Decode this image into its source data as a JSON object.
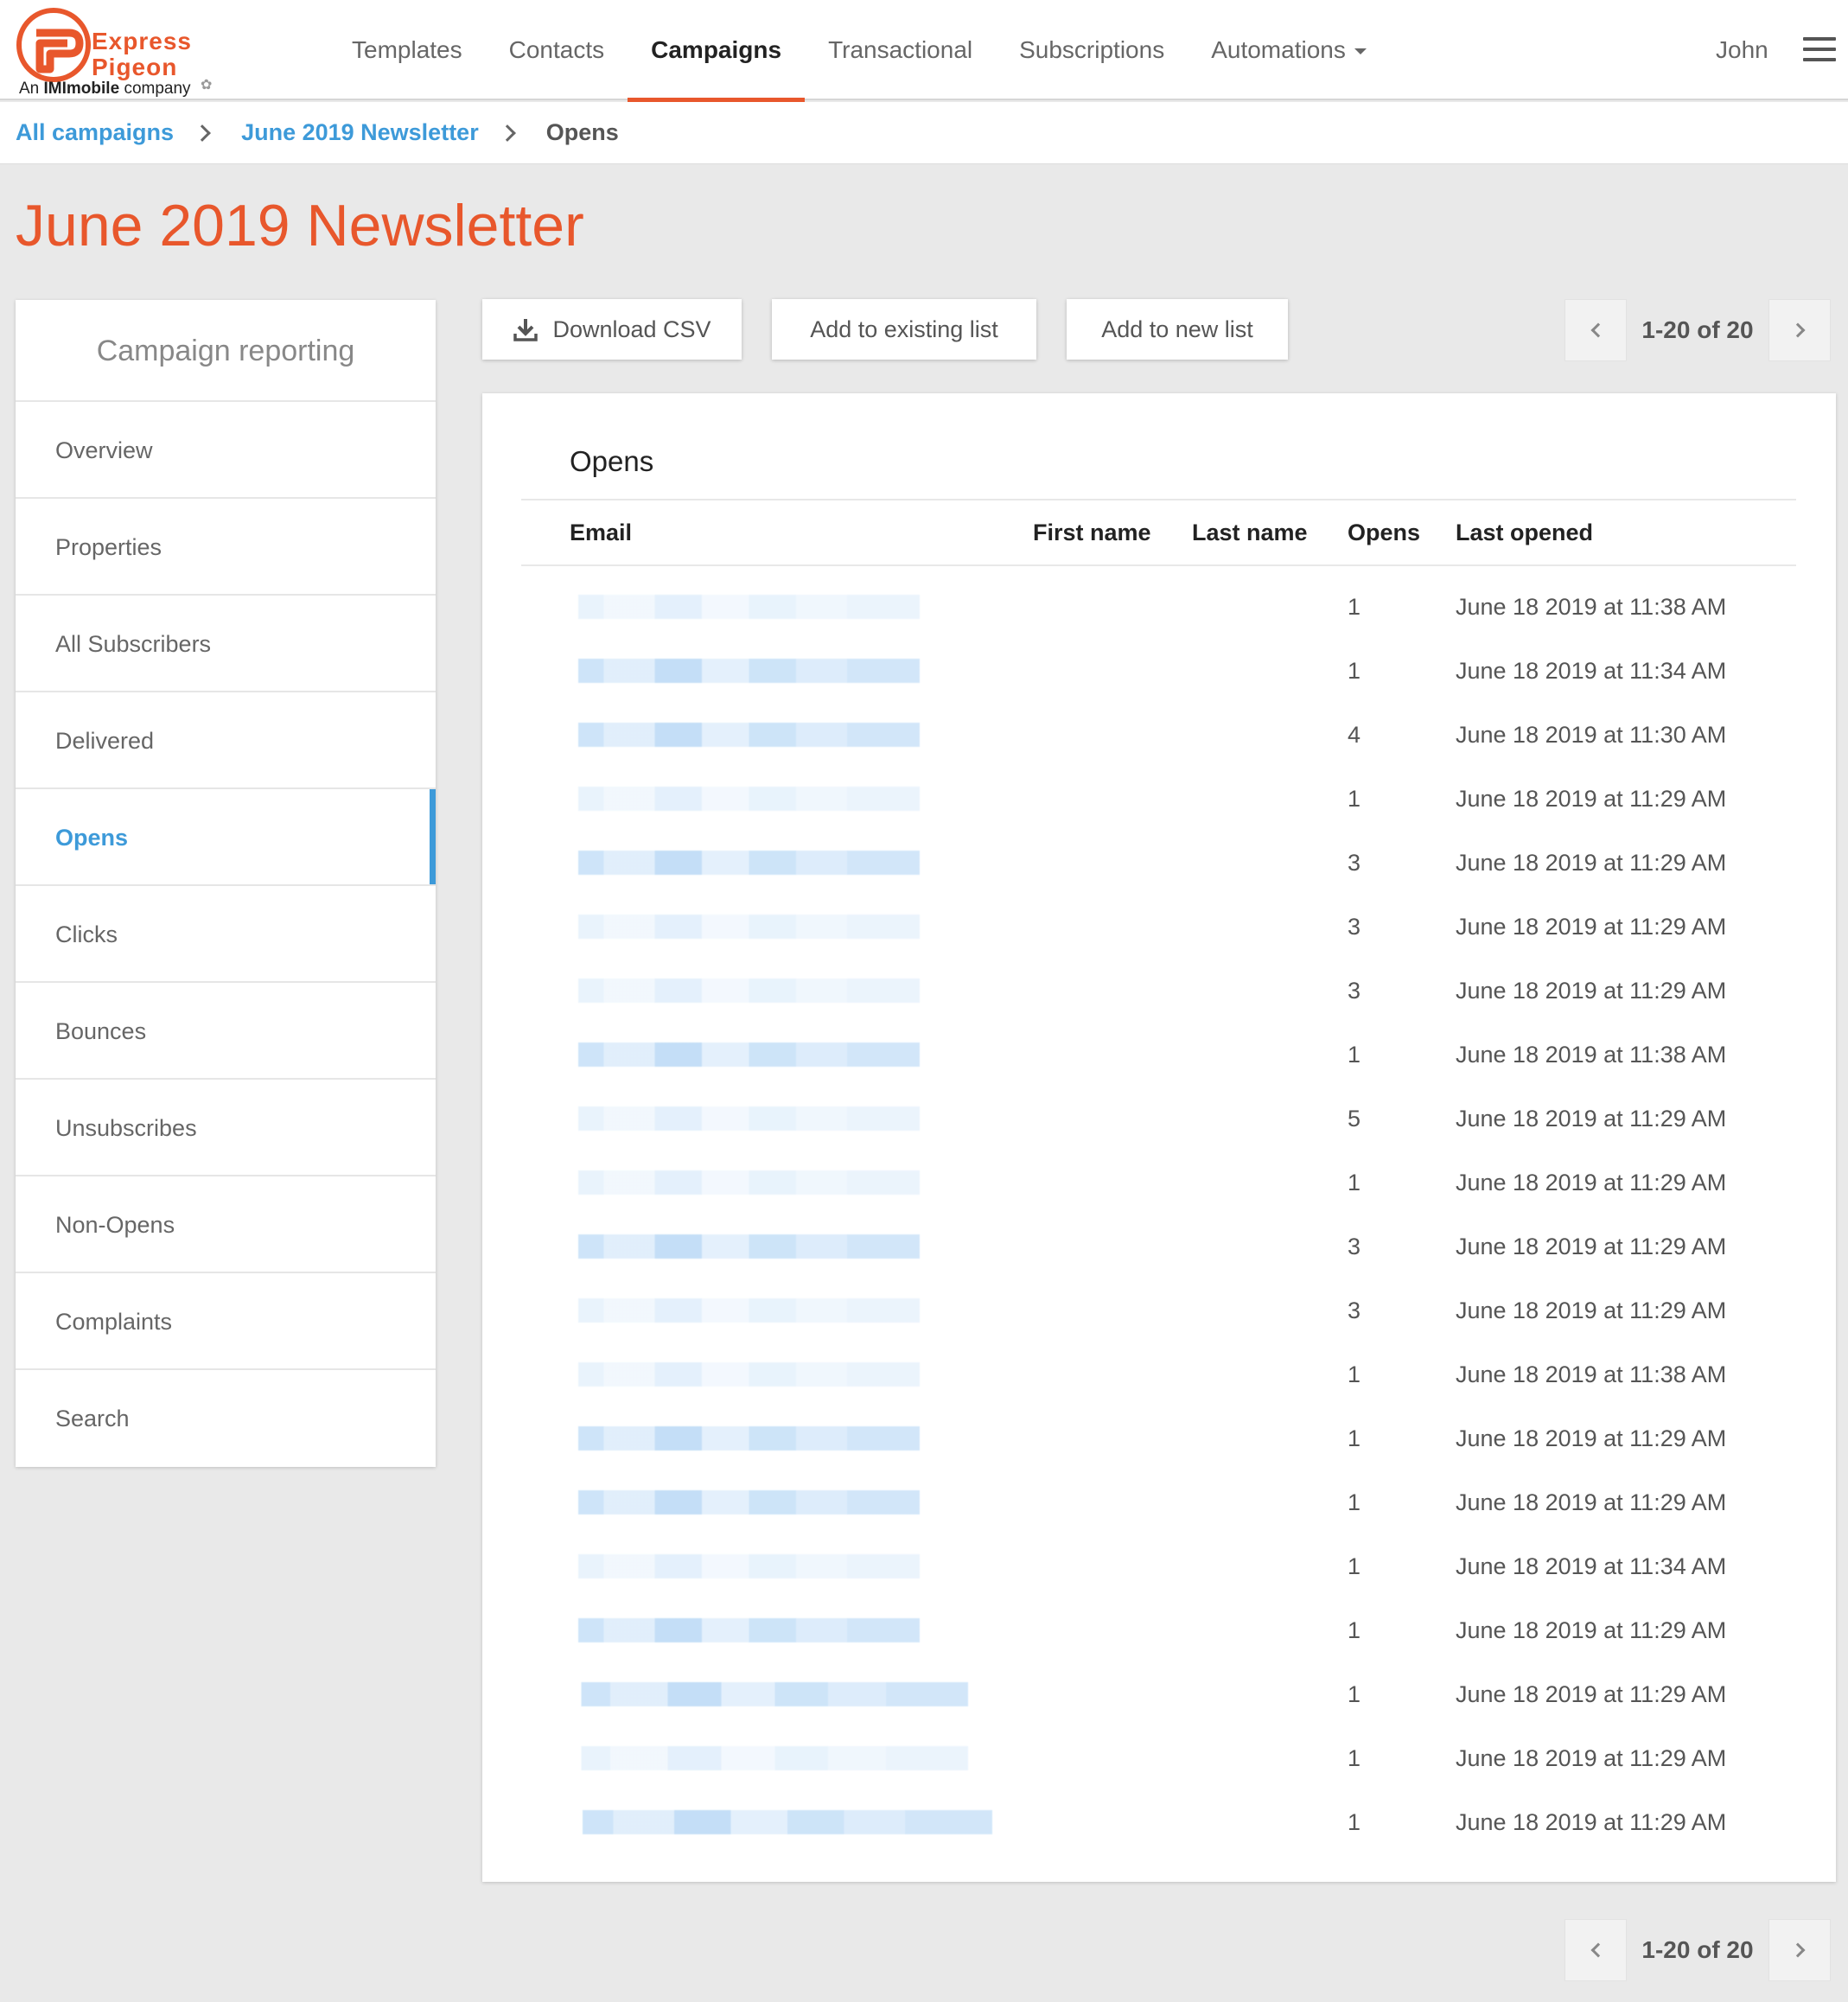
{
  "brand": {
    "line1": "Express",
    "line2": "Pigeon",
    "sub_prefix": "An",
    "sub_bold": "IMImobile",
    "sub_suffix": "company",
    "accent": "#e8572c",
    "link": "#3d9ad9"
  },
  "nav": {
    "items": [
      "Templates",
      "Contacts",
      "Campaigns",
      "Transactional",
      "Subscriptions",
      "Automations"
    ],
    "active": "Campaigns",
    "user": "John"
  },
  "breadcrumb": {
    "all": "All campaigns",
    "campaign": "June 2019 Newsletter",
    "current": "Opens"
  },
  "page_title": "June 2019 Newsletter",
  "sidebar": {
    "heading": "Campaign reporting",
    "items": [
      "Overview",
      "Properties",
      "All Subscribers",
      "Delivered",
      "Opens",
      "Clicks",
      "Bounces",
      "Unsubscribes",
      "Non-Opens",
      "Complaints",
      "Search"
    ],
    "active": "Opens"
  },
  "toolbar": {
    "download_label": "Download CSV",
    "existing_label": "Add to existing list",
    "new_label": "Add to new list"
  },
  "pagination": {
    "label": "1-20 of 20"
  },
  "table": {
    "title": "Opens",
    "columns": [
      "Email",
      "First name",
      "Last name",
      "Opens",
      "Last opened"
    ],
    "rows": [
      {
        "opens": "1",
        "last_opened": "June 18 2019 at 11:38 AM"
      },
      {
        "opens": "1",
        "last_opened": "June 18 2019 at 11:34 AM"
      },
      {
        "opens": "4",
        "last_opened": "June 18 2019 at 11:30 AM"
      },
      {
        "opens": "1",
        "last_opened": "June 18 2019 at 11:29 AM"
      },
      {
        "opens": "3",
        "last_opened": "June 18 2019 at 11:29 AM"
      },
      {
        "opens": "3",
        "last_opened": "June 18 2019 at 11:29 AM"
      },
      {
        "opens": "3",
        "last_opened": "June 18 2019 at 11:29 AM"
      },
      {
        "opens": "1",
        "last_opened": "June 18 2019 at 11:38 AM"
      },
      {
        "opens": "5",
        "last_opened": "June 18 2019 at 11:29 AM"
      },
      {
        "opens": "1",
        "last_opened": "June 18 2019 at 11:29 AM"
      },
      {
        "opens": "3",
        "last_opened": "June 18 2019 at 11:29 AM"
      },
      {
        "opens": "3",
        "last_opened": "June 18 2019 at 11:29 AM"
      },
      {
        "opens": "1",
        "last_opened": "June 18 2019 at 11:38 AM"
      },
      {
        "opens": "1",
        "last_opened": "June 18 2019 at 11:29 AM"
      },
      {
        "opens": "1",
        "last_opened": "June 18 2019 at 11:29 AM"
      },
      {
        "opens": "1",
        "last_opened": "June 18 2019 at 11:34 AM"
      },
      {
        "opens": "1",
        "last_opened": "June 18 2019 at 11:29 AM"
      },
      {
        "opens": "1",
        "last_opened": "June 18 2019 at 11:29 AM"
      },
      {
        "opens": "1",
        "last_opened": "June 18 2019 at 11:29 AM"
      },
      {
        "opens": "1",
        "last_opened": "June 18 2019 at 11:29 AM"
      }
    ]
  }
}
